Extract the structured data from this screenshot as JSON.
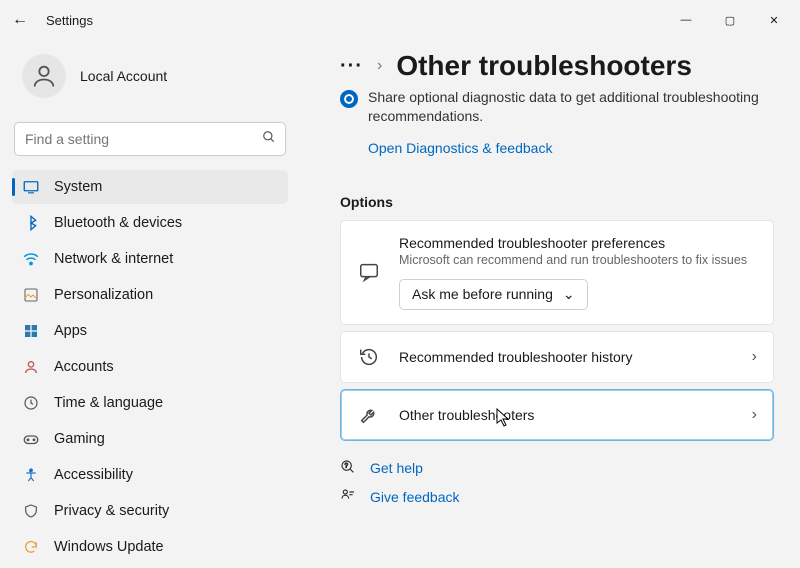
{
  "window": {
    "title": "Settings"
  },
  "account": {
    "name": "Local Account"
  },
  "search": {
    "placeholder": "Find a setting"
  },
  "sidebar": {
    "items": [
      {
        "label": "System"
      },
      {
        "label": "Bluetooth & devices"
      },
      {
        "label": "Network & internet"
      },
      {
        "label": "Personalization"
      },
      {
        "label": "Apps"
      },
      {
        "label": "Accounts"
      },
      {
        "label": "Time & language"
      },
      {
        "label": "Gaming"
      },
      {
        "label": "Accessibility"
      },
      {
        "label": "Privacy & security"
      },
      {
        "label": "Windows Update"
      }
    ]
  },
  "breadcrumb": {
    "title": "Other troubleshooters"
  },
  "note": {
    "text": "Share optional diagnostic data to get additional troubleshooting recommendations.",
    "link": "Open Diagnostics & feedback"
  },
  "options": {
    "heading": "Options",
    "pref": {
      "title": "Recommended troubleshooter preferences",
      "sub": "Microsoft can recommend and run troubleshooters to fix issues",
      "dropdown": "Ask me before running"
    },
    "history": {
      "title": "Recommended troubleshooter history"
    },
    "other": {
      "title": "Other troubleshooters"
    }
  },
  "footer": {
    "help": "Get help",
    "feedback": "Give feedback"
  }
}
